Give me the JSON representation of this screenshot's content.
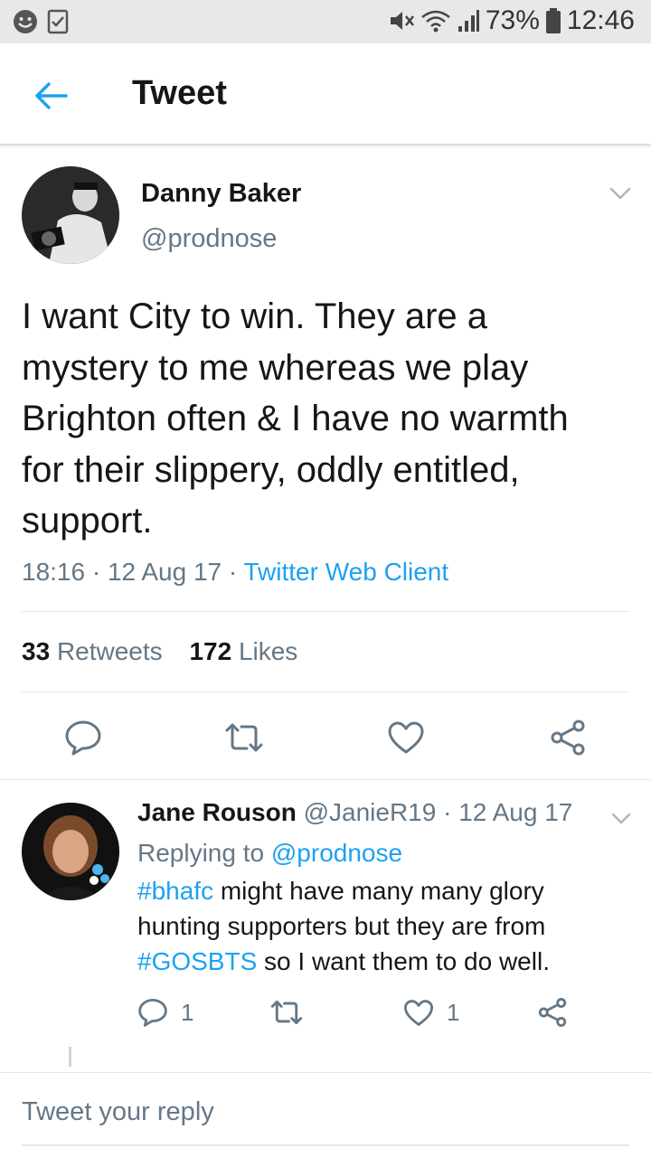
{
  "status_bar": {
    "battery": "73%",
    "time": "12:46"
  },
  "app_bar": {
    "title": "Tweet"
  },
  "tweet": {
    "author_name": "Danny Baker",
    "author_handle": "@prodnose",
    "text": "I want City to win. They are a mystery to me whereas we play Brighton often & I have no warmth for their slippery, oddly entitled, support.",
    "time": "18:16",
    "date": "12 Aug 17",
    "separator": " · ",
    "source": "Twitter Web Client",
    "retweets_count": "33",
    "retweets_label": "Retweets",
    "likes_count": "172",
    "likes_label": "Likes"
  },
  "reply": {
    "author_name": "Jane Rouson",
    "author_handle": "@JanieR19",
    "date": "12 Aug 17",
    "replying_label": "Replying to",
    "replying_to": "@prodnose",
    "tag1": "#bhafc",
    "text1": " might have many many glory hunting supporters but they are from ",
    "tag2": "#GOSBTS",
    "text2": " so I want them to do well.",
    "reply_count": "1",
    "like_count": "1"
  },
  "composer": {
    "placeholder": "Tweet your reply"
  },
  "colors": {
    "accent": "#1da1f2",
    "icon": "#657786",
    "text": "#14171a",
    "status_bar_bg": "#e8e8e8"
  },
  "icons": [
    "smiley-face-icon",
    "checkbox-icon",
    "mute-icon",
    "wifi-icon",
    "signal-icon",
    "battery-icon",
    "back-arrow-icon",
    "chevron-down-icon",
    "reply-icon",
    "retweet-icon",
    "heart-icon",
    "share-icon"
  ]
}
